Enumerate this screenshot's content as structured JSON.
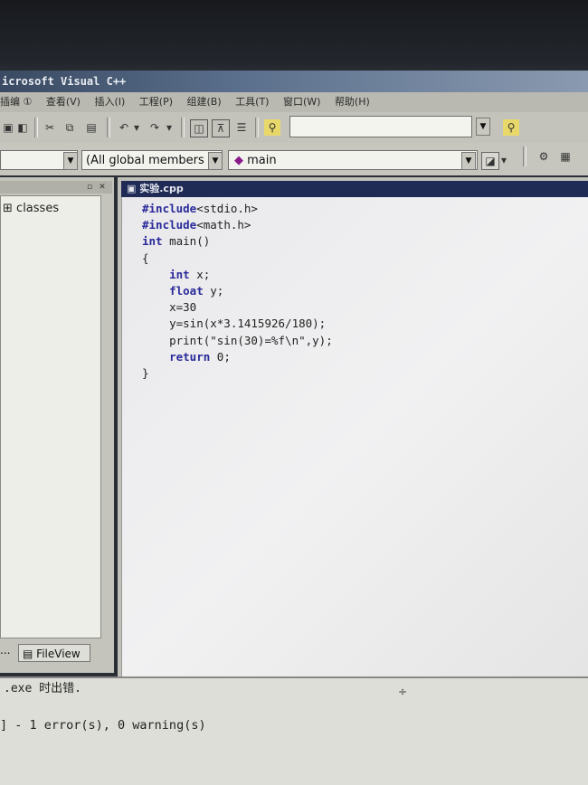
{
  "window": {
    "title": "icrosoft Visual C++"
  },
  "menu": [
    "插编 ①",
    "查看(V)",
    "插入(I)",
    "工程(P)",
    "组建(B)",
    "工具(T)",
    "窗口(W)",
    "帮助(H)"
  ],
  "toolbar2": {
    "class_combo": "",
    "members_combo": "(All global members",
    "function_combo": "main"
  },
  "classview": {
    "label": "classes",
    "tab_label": "FileView",
    "tab_left_label": "..."
  },
  "editor": {
    "tab_title": "实验.cpp",
    "lines": [
      "#include<stdio.h>",
      "#include<math.h>",
      "int main()",
      "{",
      "    int x;",
      "    float y;",
      "    x=30",
      "    y=sin(x*3.1415926/180);",
      "    print(\"sin(30)=%f\\n\",y);",
      "    return 0;",
      "}"
    ]
  },
  "output": {
    "line1": ".exe 时出错.",
    "line2": "] - 1 error(s), 0 warning(s)"
  },
  "colors": {
    "keyword": "#2a2a9a",
    "title_bar": "#1f2a55"
  }
}
